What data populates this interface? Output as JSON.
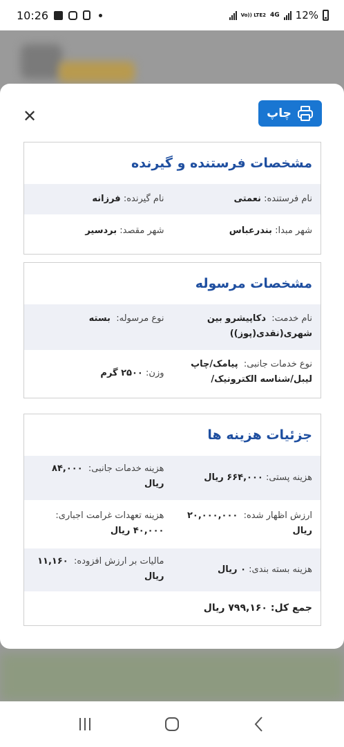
{
  "status_bar": {
    "time": "10:26",
    "network": "4G",
    "volte": "Vo)) LTE2",
    "battery": "12%"
  },
  "modal": {
    "print_label": "چاپ",
    "close_glyph": "✕",
    "sections": {
      "parties": {
        "title": "مشخصات فرستنده و گیرنده",
        "sender_name_label": "نام فرستنده:",
        "sender_name": "نعمتی",
        "receiver_name_label": "نام گیرنده:",
        "receiver_name": "فرزانه",
        "origin_city_label": "شهر مبدا:",
        "origin_city": "بندرعباس",
        "dest_city_label": "شهر مقصد:",
        "dest_city": "بردسیر"
      },
      "parcel": {
        "title": "مشخصات مرسوله",
        "service_name_label": "نام خدمت:",
        "service_name": "دکاپیشرو بین شهری(نقدی(پوز))",
        "parcel_type_label": "نوع مرسوله:",
        "parcel_type": "بسته",
        "side_services_label": "نوع خدمات جانبی:",
        "side_services": "پیامک/چاپ لیبل/شناسه الکترونیک/",
        "weight_label": "وزن:",
        "weight": "۲۵۰۰ گرم"
      },
      "costs": {
        "title": "جزئیات هزینه ها",
        "postal_fee_label": "هزینه پستی:",
        "postal_fee": "۶۶۴,۰۰۰ ریال",
        "side_services_fee_label": "هزینه خدمات جانبی:",
        "side_services_fee": "۸۴,۰۰۰ ریال",
        "declared_value_label": "ارزش اظهار شده:",
        "declared_value": "۲۰,۰۰۰,۰۰۰ ریال",
        "compensation_fee_label": "هزینه تعهدات غرامت اجباری:",
        "compensation_fee": "۴۰,۰۰۰ ریال",
        "packaging_fee_label": "هزینه بسته بندی:",
        "packaging_fee": "۰ ریال",
        "vat_label": "مالیات بر ارزش افزوده:",
        "vat": "۱۱,۱۶۰ ریال",
        "total_label": "جمع کل:",
        "total": "۷۹۹,۱۶۰ ریال"
      }
    }
  },
  "colors": {
    "accent": "#1976d2",
    "section_title": "#1f4fa0",
    "row_shade": "#eef0f6"
  }
}
